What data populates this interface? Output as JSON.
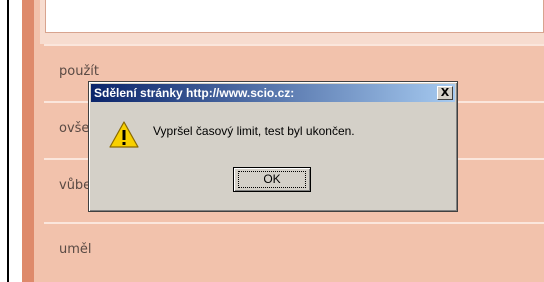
{
  "background_rows": [
    {
      "label": "použít"
    },
    {
      "label": "ovše"
    },
    {
      "label": "vůbe"
    },
    {
      "label": "uměl"
    }
  ],
  "dialog": {
    "title": "Sdělení stránky http://www.scio.cz:",
    "close_label": "X",
    "message": "Vypršel časový limit, test byl ukončen.",
    "icon": "warning-icon",
    "ok_label": "OK"
  },
  "colors": {
    "page_panel": "#f2c2ac",
    "accent_bar": "#de8a6b",
    "dialog_face": "#d4d0c8",
    "titlebar_start": "#0a246a",
    "titlebar_end": "#a6caf0",
    "warning_fill": "#f8d000"
  }
}
